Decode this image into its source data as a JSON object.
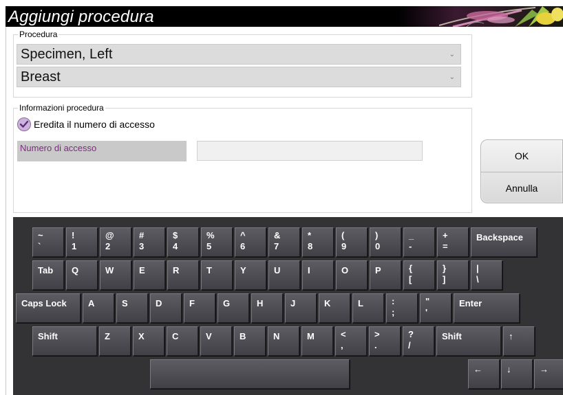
{
  "window": {
    "title": "Aggiungi procedura"
  },
  "procedure_group": {
    "legend": "Procedura",
    "view_select": "Specimen, Left",
    "body_part_select": "Breast"
  },
  "info_group": {
    "legend": "Informazioni procedura",
    "inherit_checkbox_label": "Eredita il numero di accesso",
    "inherit_checked": true,
    "accession_label": "Numero di accesso",
    "accession_value": ""
  },
  "buttons": {
    "ok": "OK",
    "cancel": "Annulla"
  },
  "keyboard": {
    "row1": [
      {
        "top": "~",
        "bottom": "`"
      },
      {
        "top": "!",
        "bottom": "1"
      },
      {
        "top": "@",
        "bottom": "2"
      },
      {
        "top": "#",
        "bottom": "3"
      },
      {
        "top": "$",
        "bottom": "4"
      },
      {
        "top": "%",
        "bottom": "5"
      },
      {
        "top": "^",
        "bottom": "6"
      },
      {
        "top": "&",
        "bottom": "7"
      },
      {
        "top": "*",
        "bottom": "8"
      },
      {
        "top": "(",
        "bottom": "9"
      },
      {
        "top": ")",
        "bottom": "0"
      },
      {
        "top": "_",
        "bottom": "-"
      },
      {
        "top": "+",
        "bottom": "="
      },
      {
        "label": "Backspace"
      }
    ],
    "row2": [
      {
        "label": "Tab"
      },
      {
        "label": "Q"
      },
      {
        "label": "W"
      },
      {
        "label": "E"
      },
      {
        "label": "R"
      },
      {
        "label": "T"
      },
      {
        "label": "Y"
      },
      {
        "label": "U"
      },
      {
        "label": "I"
      },
      {
        "label": "O"
      },
      {
        "label": "P"
      },
      {
        "top": "{",
        "bottom": "["
      },
      {
        "top": "}",
        "bottom": "]"
      },
      {
        "top": "|",
        "bottom": "\\"
      }
    ],
    "row3": [
      {
        "label": "Caps Lock"
      },
      {
        "label": "A"
      },
      {
        "label": "S"
      },
      {
        "label": "D"
      },
      {
        "label": "F"
      },
      {
        "label": "G"
      },
      {
        "label": "H"
      },
      {
        "label": "J"
      },
      {
        "label": "K"
      },
      {
        "label": "L"
      },
      {
        "top": ":",
        "bottom": ";"
      },
      {
        "top": "\"",
        "bottom": "'"
      },
      {
        "label": "Enter"
      }
    ],
    "row4": [
      {
        "label": "Shift"
      },
      {
        "label": "Z"
      },
      {
        "label": "X"
      },
      {
        "label": "C"
      },
      {
        "label": "V"
      },
      {
        "label": "B"
      },
      {
        "label": "N"
      },
      {
        "label": "M"
      },
      {
        "top": "<",
        "bottom": ","
      },
      {
        "top": ">",
        "bottom": "."
      },
      {
        "top": "?",
        "bottom": "/"
      },
      {
        "label": "Shift"
      },
      {
        "label": "↑"
      }
    ],
    "row5": [
      {
        "label": ""
      },
      {
        "label": "←"
      },
      {
        "label": "↓"
      },
      {
        "label": "→"
      }
    ]
  }
}
